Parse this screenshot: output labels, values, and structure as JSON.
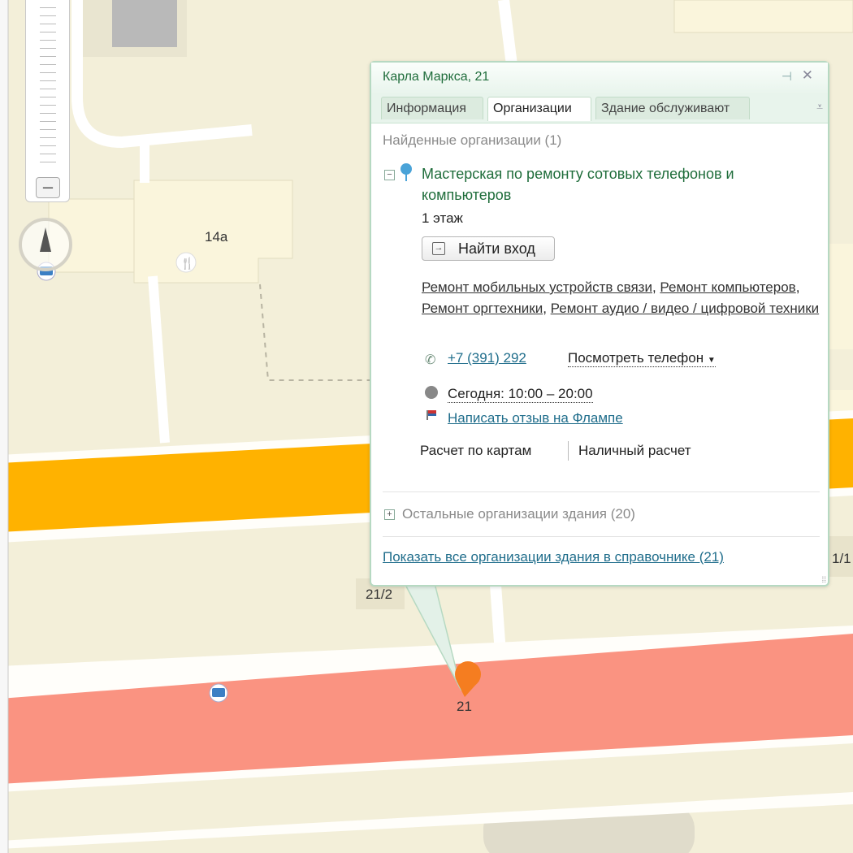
{
  "map": {
    "house_labels": {
      "b14a": "14а",
      "b21_2": "21/2",
      "b21": "21",
      "b1_1": "1/1"
    },
    "icons": [
      "restaurant-icon",
      "transport-icon",
      "location-pin-icon"
    ],
    "colors": {
      "ground": "#f3efd9",
      "orange_road": "#ffb200",
      "red_road": "#fa9381",
      "building": "#faf5dc"
    }
  },
  "popup": {
    "title": "Карла Маркса, 21",
    "tabs": [
      "Информация",
      "Организации",
      "Здание обслуживают"
    ],
    "active_tab": "Организации",
    "found_label": "Найденные организации (1)",
    "org_name": "Мастерская по ремонту сотовых телефонов и компьютеров",
    "floor": "1 этаж",
    "find_entrance": "Найти вход",
    "categories": [
      "Ремонт мобильных устройств связи",
      "Ремонт компьютеров",
      "Ремонт оргтехники",
      "Ремонт аудио / видео / цифровой техники"
    ],
    "phone": "+7 (391) 292",
    "show_phone": "Посмотреть телефон",
    "hours": "Сегодня: 10:00 – 20:00",
    "review_link": "Написать отзыв на Флампе",
    "payment": [
      "Расчет по картам",
      "Наличный расчет"
    ],
    "others_label": "Остальные организации здания (20)",
    "show_all": "Показать все организации здания в справочнике (21)",
    "accent_color": "#1f6d3b"
  }
}
